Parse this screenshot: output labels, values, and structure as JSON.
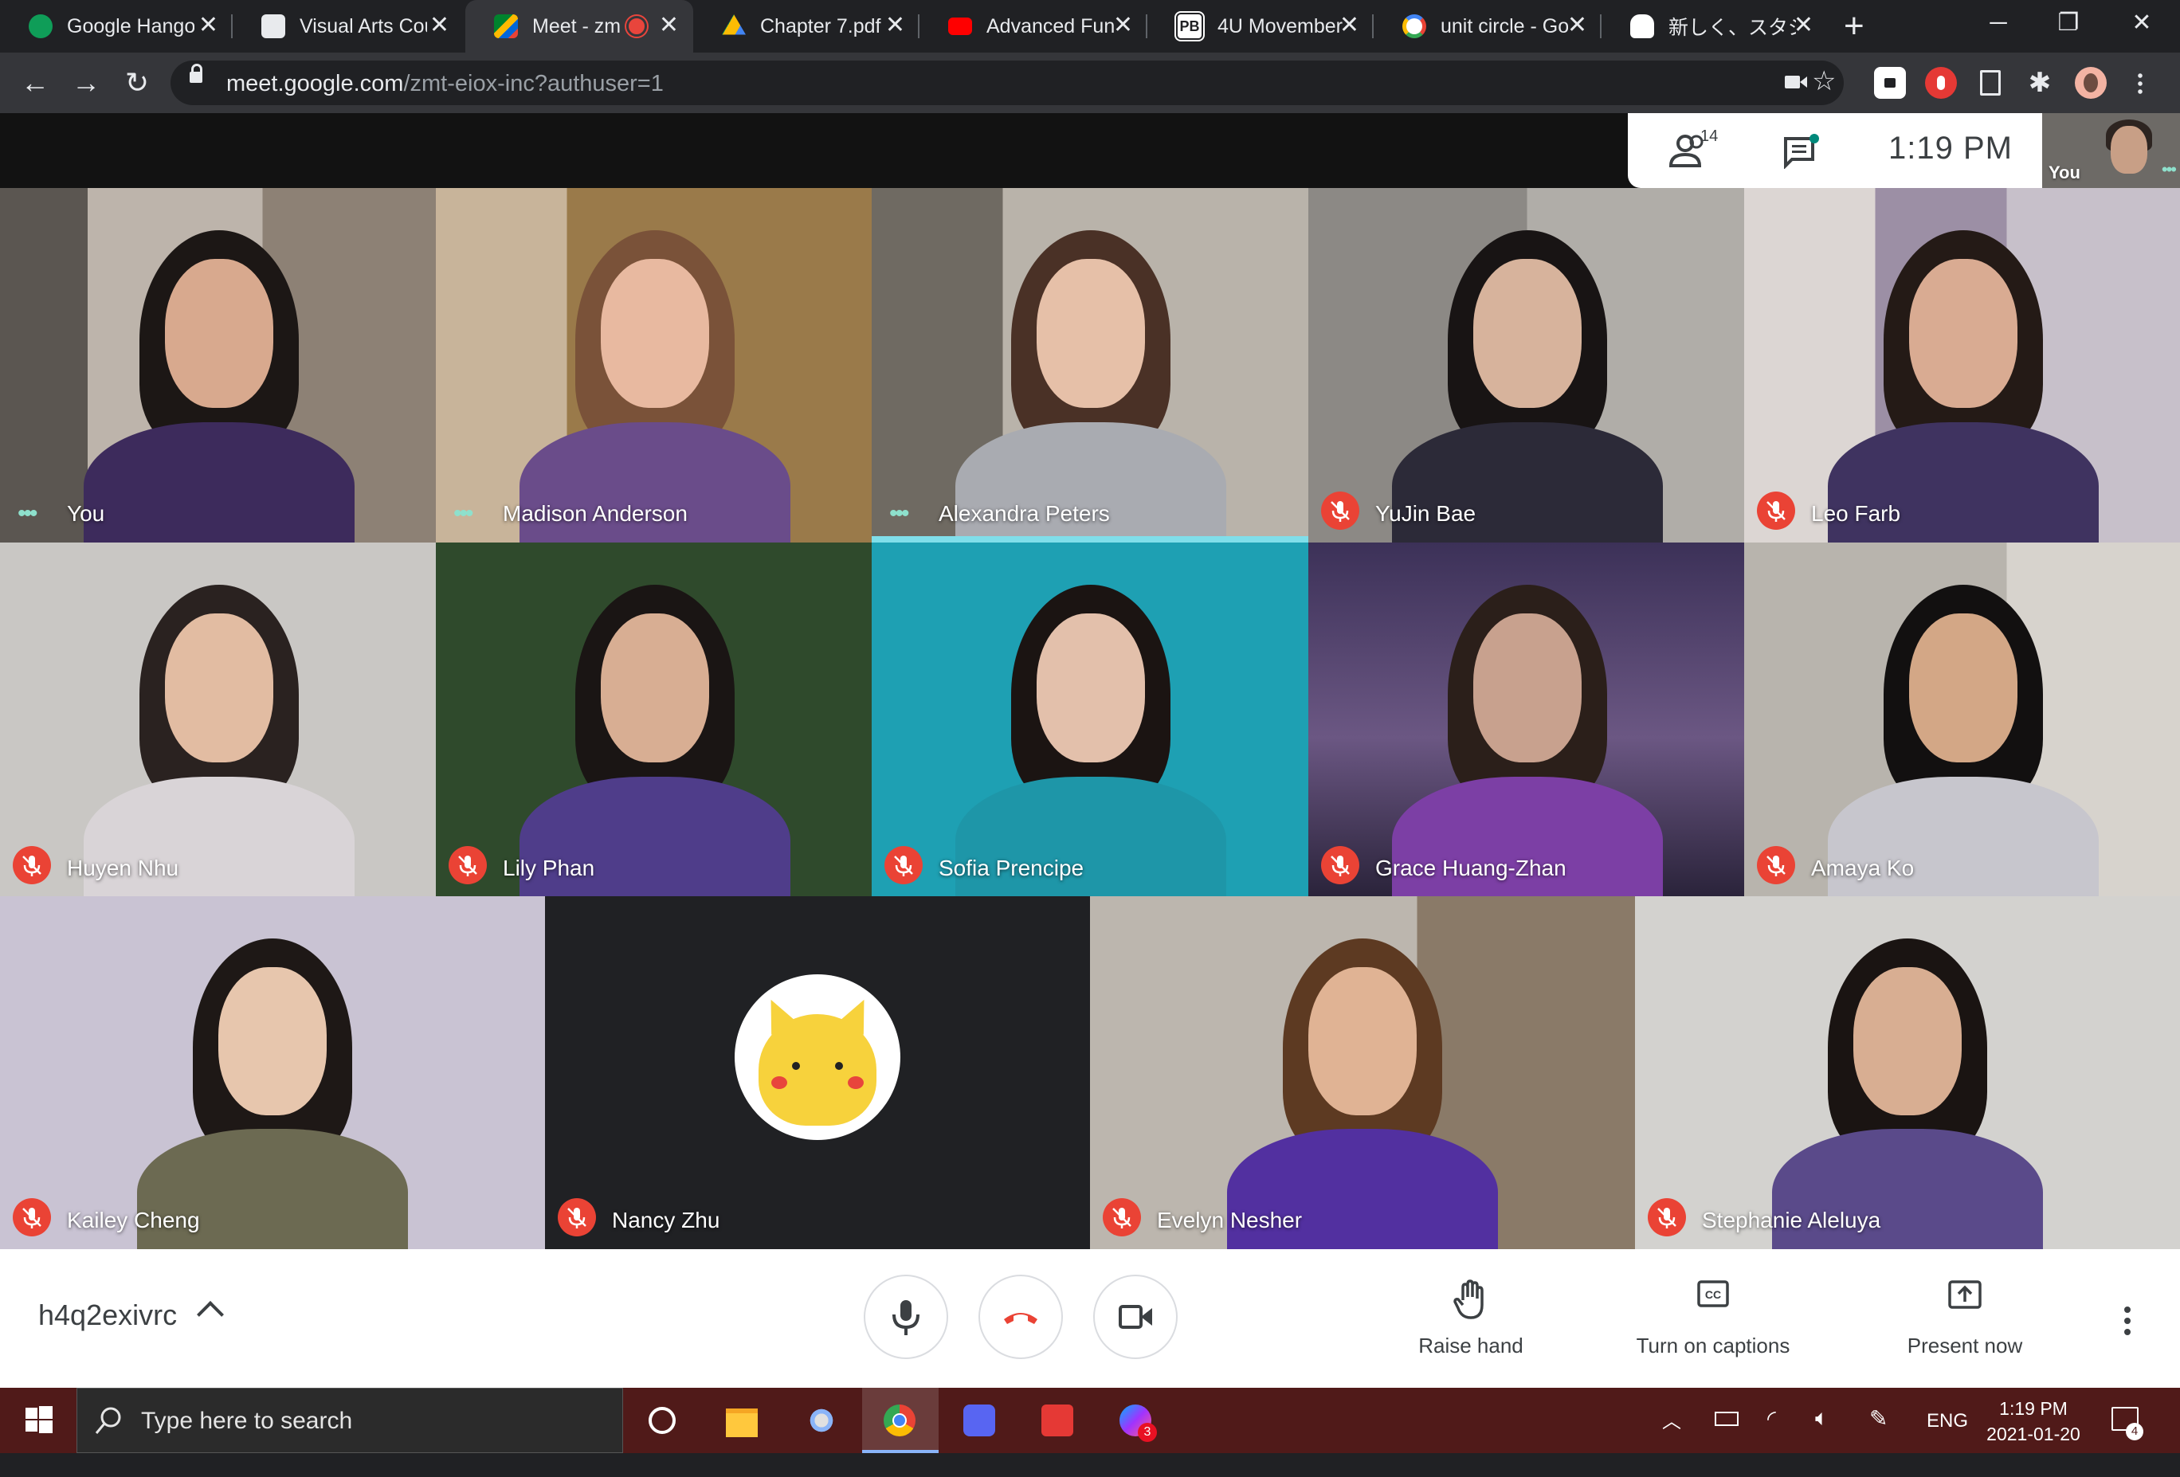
{
  "browser": {
    "tabs": [
      {
        "label": "Google Hango",
        "icon": "hangouts-icon",
        "color": "#0f9d58"
      },
      {
        "label": "Visual Arts Cou",
        "icon": "classroom-icon",
        "color": "#ffffff"
      },
      {
        "label": "Meet - zm",
        "icon": "meet-icon",
        "color": "#00897b",
        "active": true,
        "recording": true
      },
      {
        "label": "Chapter 7.pdf",
        "icon": "google-drive-icon",
        "color": "#fbbc04"
      },
      {
        "label": "Advanced Fun",
        "icon": "youtube-icon",
        "color": "#ff0000"
      },
      {
        "label": "4U Movember",
        "icon": "pb-icon",
        "color": "#ffffff"
      },
      {
        "label": "unit circle - Go",
        "icon": "google-icon",
        "color": "#4285f4"
      },
      {
        "label": "新しく、スタジオ",
        "icon": "cat-icon",
        "color": "#ffffff"
      }
    ],
    "new_tab": "+",
    "url_host": "meet.google.com",
    "url_path": "/zmt-eiox-inc?authuser=1"
  },
  "meet": {
    "participant_count": "14",
    "clock": "1:19 PM",
    "self_label": "You",
    "participants": [
      {
        "name": "You",
        "status": "dots"
      },
      {
        "name": "Madison Anderson",
        "status": "dots"
      },
      {
        "name": "Alexandra Peters",
        "status": "dots",
        "speaking": true
      },
      {
        "name": "YuJin Bae",
        "status": "muted"
      },
      {
        "name": "Leo Farb",
        "status": "muted"
      },
      {
        "name": "Huyen Nhu",
        "status": "muted"
      },
      {
        "name": "Lily Phan",
        "status": "muted"
      },
      {
        "name": "Sofia Prencipe",
        "status": "muted"
      },
      {
        "name": "Grace Huang-Zhan",
        "status": "muted"
      },
      {
        "name": "Amaya Ko",
        "status": "muted"
      },
      {
        "name": "Kailey Cheng",
        "status": "muted"
      },
      {
        "name": "Nancy Zhu",
        "status": "muted",
        "avatar": "pikachu-avatar"
      },
      {
        "name": "Evelyn Nesher",
        "status": "muted"
      },
      {
        "name": "Stephanie Aleluya",
        "status": "muted"
      }
    ],
    "meeting_code": "h4q2exivrc",
    "actions": {
      "raise_hand": "Raise hand",
      "captions": "Turn on captions",
      "present": "Present now"
    },
    "colors": {
      "muted": "#ea4335",
      "leave": "#ea4335",
      "speaking": "#80deea"
    }
  },
  "taskbar": {
    "search_placeholder": "Type here to search",
    "language": "ENG",
    "time": "1:19 PM",
    "date": "2021-01-20",
    "notification_count": "4",
    "badge_count": "3"
  }
}
